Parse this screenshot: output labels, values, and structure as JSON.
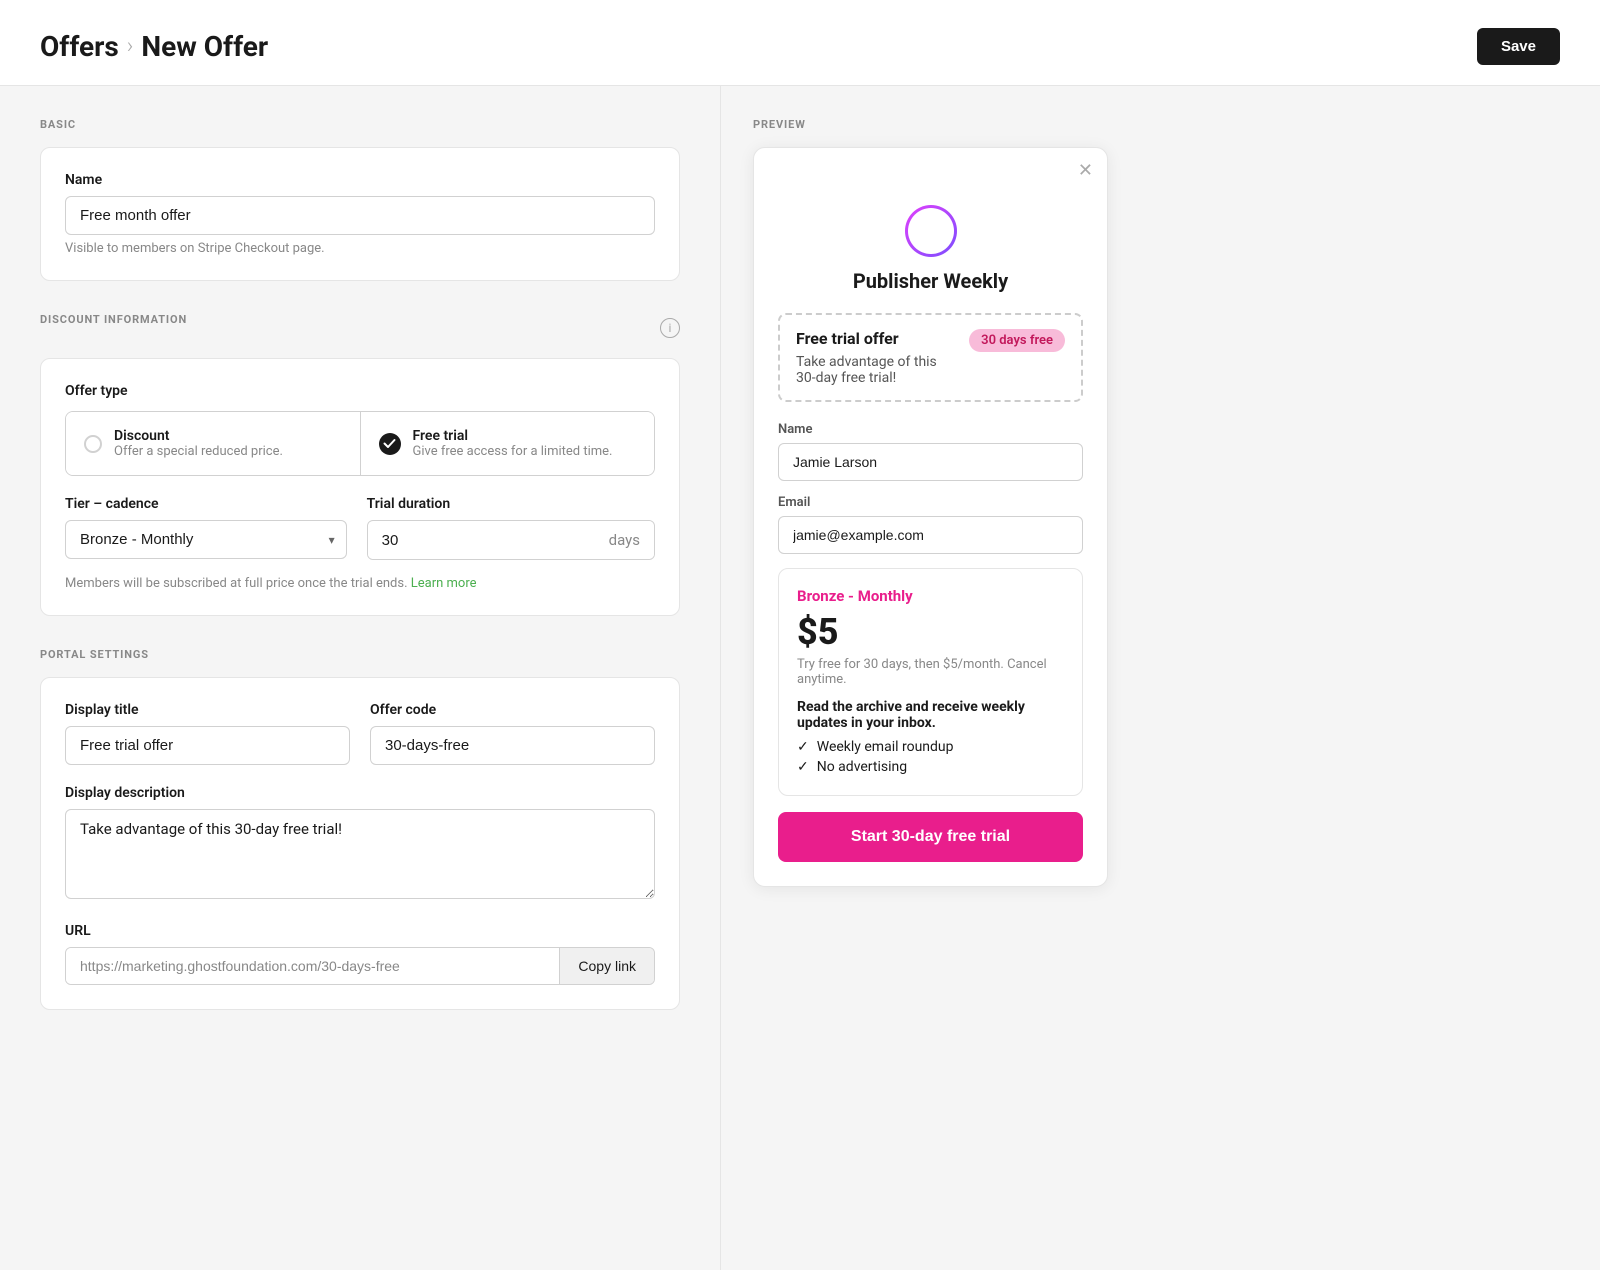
{
  "header": {
    "breadcrumb_parent": "Offers",
    "breadcrumb_separator": "›",
    "breadcrumb_current": "New Offer",
    "save_label": "Save"
  },
  "basic_section": {
    "label": "BASIC",
    "name_label": "Name",
    "name_value": "Free month offer",
    "name_hint": "Visible to members on Stripe Checkout page."
  },
  "discount_section": {
    "label": "DISCOUNT INFORMATION",
    "offer_type_label": "Offer type",
    "discount_title": "Discount",
    "discount_desc": "Offer a special reduced price.",
    "free_trial_title": "Free trial",
    "free_trial_desc": "Give free access for a limited time.",
    "tier_cadence_label": "Tier – cadence",
    "tier_cadence_value": "Bronze - Monthly",
    "trial_duration_label": "Trial duration",
    "trial_duration_value": "30",
    "trial_duration_unit": "days",
    "hint_text": "Members will be subscribed at full price once the trial ends.",
    "learn_more": "Learn more"
  },
  "portal_section": {
    "label": "PORTAL SETTINGS",
    "display_title_label": "Display title",
    "display_title_value": "Free trial offer",
    "offer_code_label": "Offer code",
    "offer_code_value": "30-days-free",
    "display_description_label": "Display description",
    "display_description_value": "Take advantage of this 30-day free trial!",
    "url_label": "URL",
    "url_value": "https://marketing.ghostfoundation.com/30-days-free",
    "copy_link_label": "Copy link"
  },
  "preview": {
    "label": "PREVIEW",
    "pub_name": "Publisher Weekly",
    "offer_title": "Free trial offer",
    "offer_badge": "30 days free",
    "offer_desc": "Take advantage of this 30-day free trial!",
    "name_label": "Name",
    "name_placeholder": "Jamie Larson",
    "email_label": "Email",
    "email_placeholder": "jamie@example.com",
    "tier_name": "Bronze - Monthly",
    "tier_price": "$5",
    "tier_price_hint": "Try free for 30 days, then $5/month. Cancel anytime.",
    "tier_desc": "Read the archive and receive weekly updates in your inbox.",
    "features": [
      "Weekly email roundup",
      "No advertising"
    ],
    "cta_label": "Start 30-day free trial"
  }
}
